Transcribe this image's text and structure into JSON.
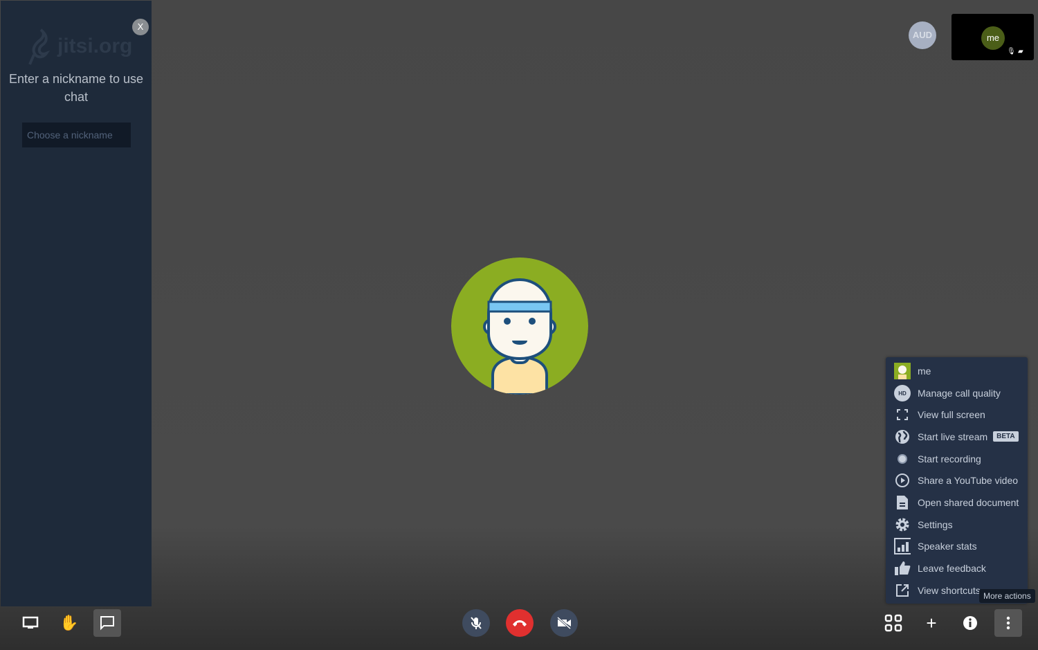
{
  "chat": {
    "close_label": "X",
    "logo_text": "jitsi.org",
    "prompt": "Enter a nickname to use chat",
    "nickname_placeholder": "Choose a nickname",
    "nickname_value": ""
  },
  "filmstrip": {
    "audio_only_label": "AUD",
    "local_name": "me"
  },
  "main_avatar": {
    "background": "#8bad22"
  },
  "menu": {
    "items": [
      {
        "label": "me",
        "icon": "avatar-icon"
      },
      {
        "label": "Manage call quality",
        "icon": "hd-icon"
      },
      {
        "label": "View full screen",
        "icon": "fullscreen-icon"
      },
      {
        "label": "Start live stream",
        "icon": "globe-icon",
        "badge": "BETA"
      },
      {
        "label": "Start recording",
        "icon": "record-icon"
      },
      {
        "label": "Share a YouTube video",
        "icon": "play-icon"
      },
      {
        "label": "Open shared document",
        "icon": "document-icon"
      },
      {
        "label": "Settings",
        "icon": "gear-icon"
      },
      {
        "label": "Speaker stats",
        "icon": "stats-icon"
      },
      {
        "label": "Leave feedback",
        "icon": "thumbs-up-icon"
      },
      {
        "label": "View shortcuts",
        "icon": "external-link-icon"
      }
    ]
  },
  "tooltip": "More actions",
  "colors": {
    "hangup": "#e0302f",
    "panel": "#253146",
    "chat_bg": "#1e2a3a"
  }
}
